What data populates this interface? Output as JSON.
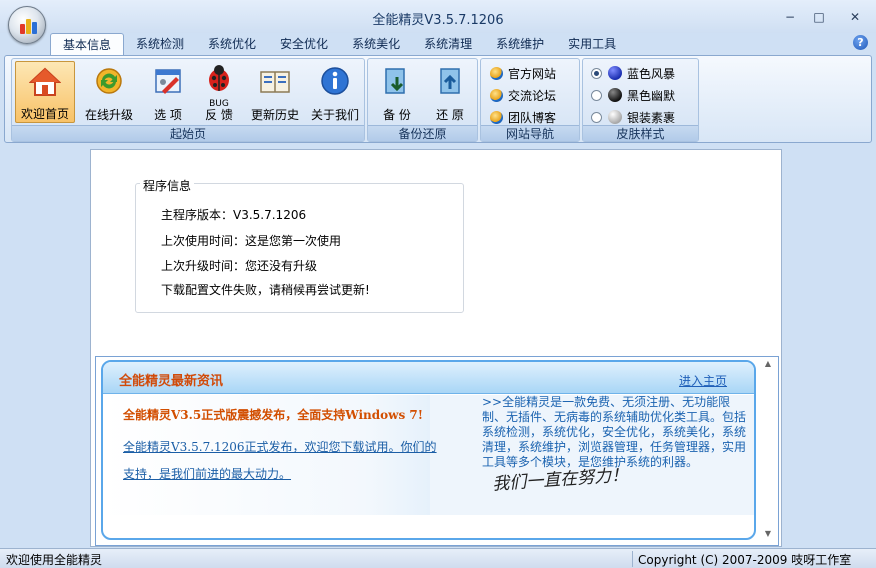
{
  "window": {
    "title": "全能精灵V3.5.7.1206",
    "minimize_glyph": "−",
    "maximize_glyph": "□",
    "close_glyph": "✕",
    "help_glyph": "?"
  },
  "tabs": [
    "基本信息",
    "系统检测",
    "系统优化",
    "安全优化",
    "系统美化",
    "系统清理",
    "系统维护",
    "实用工具"
  ],
  "ribbon": {
    "start_group": {
      "label": "起始页",
      "buttons": [
        {
          "label": "欢迎首页",
          "icon": "home-icon",
          "selected": true
        },
        {
          "label": "在线升级",
          "icon": "update-icon"
        },
        {
          "label": "选  项",
          "icon": "options-icon"
        },
        {
          "label": "反  馈",
          "sublabel": "BUG",
          "icon": "ladybug-icon"
        },
        {
          "label": "更新历史",
          "icon": "history-icon"
        },
        {
          "label": "关于我们",
          "icon": "info-icon"
        }
      ]
    },
    "backup_group": {
      "label": "备份还原",
      "buttons": [
        {
          "label": "备  份",
          "icon": "backup-icon"
        },
        {
          "label": "还  原",
          "icon": "restore-icon"
        }
      ]
    },
    "nav_group": {
      "label": "网站导航",
      "links": [
        "官方网站",
        "交流论坛",
        "团队博客"
      ]
    },
    "skin_group": {
      "label": "皮肤样式",
      "options": [
        {
          "label": "蓝色风暴",
          "color": "#1b2fb0",
          "selected": true
        },
        {
          "label": "黑色幽默",
          "color": "#1a1a1a",
          "selected": false
        },
        {
          "label": "银装素裹",
          "color": "#c9c9c9",
          "selected": false
        }
      ]
    }
  },
  "program_info": {
    "title": "程序信息",
    "version_line": "主程序版本：V3.5.7.1206",
    "last_used_line": "上次使用时间：这是您第一次使用",
    "last_upgrade_line": "上次升级时间：您还没有升级",
    "download_line": "下载配置文件失败，请稍候再尝试更新!"
  },
  "news": {
    "title": "全能精灵最新资讯",
    "more_link": "进入主页",
    "headline": "全能精灵V3.5正式版震撼发布，全面支持Windows 7!",
    "link_line1": "全能精灵V3.5.7.1206正式发布，欢迎您下载试用。你们的",
    "link_line2": "支持，是我们前进的最大动力。",
    "description": ">>全能精灵是一款免费、无须注册、无功能限制、无插件、无病毒的系统辅助优化类工具。包括系统检测，系统优化，安全优化，系统美化，系统清理，系统维护，浏览器管理，任务管理器，实用工具等多个模块，是您维护系统的利器。",
    "signature": "我们一直在努力！"
  },
  "statusbar": {
    "left": "欢迎使用全能精灵",
    "right": "Copyright (C) 2007-2009 吱呀工作室"
  },
  "colors": {
    "accent": "#d14b0a",
    "link": "#1f5fb8",
    "ribbon_border": "#8aa8cf"
  }
}
